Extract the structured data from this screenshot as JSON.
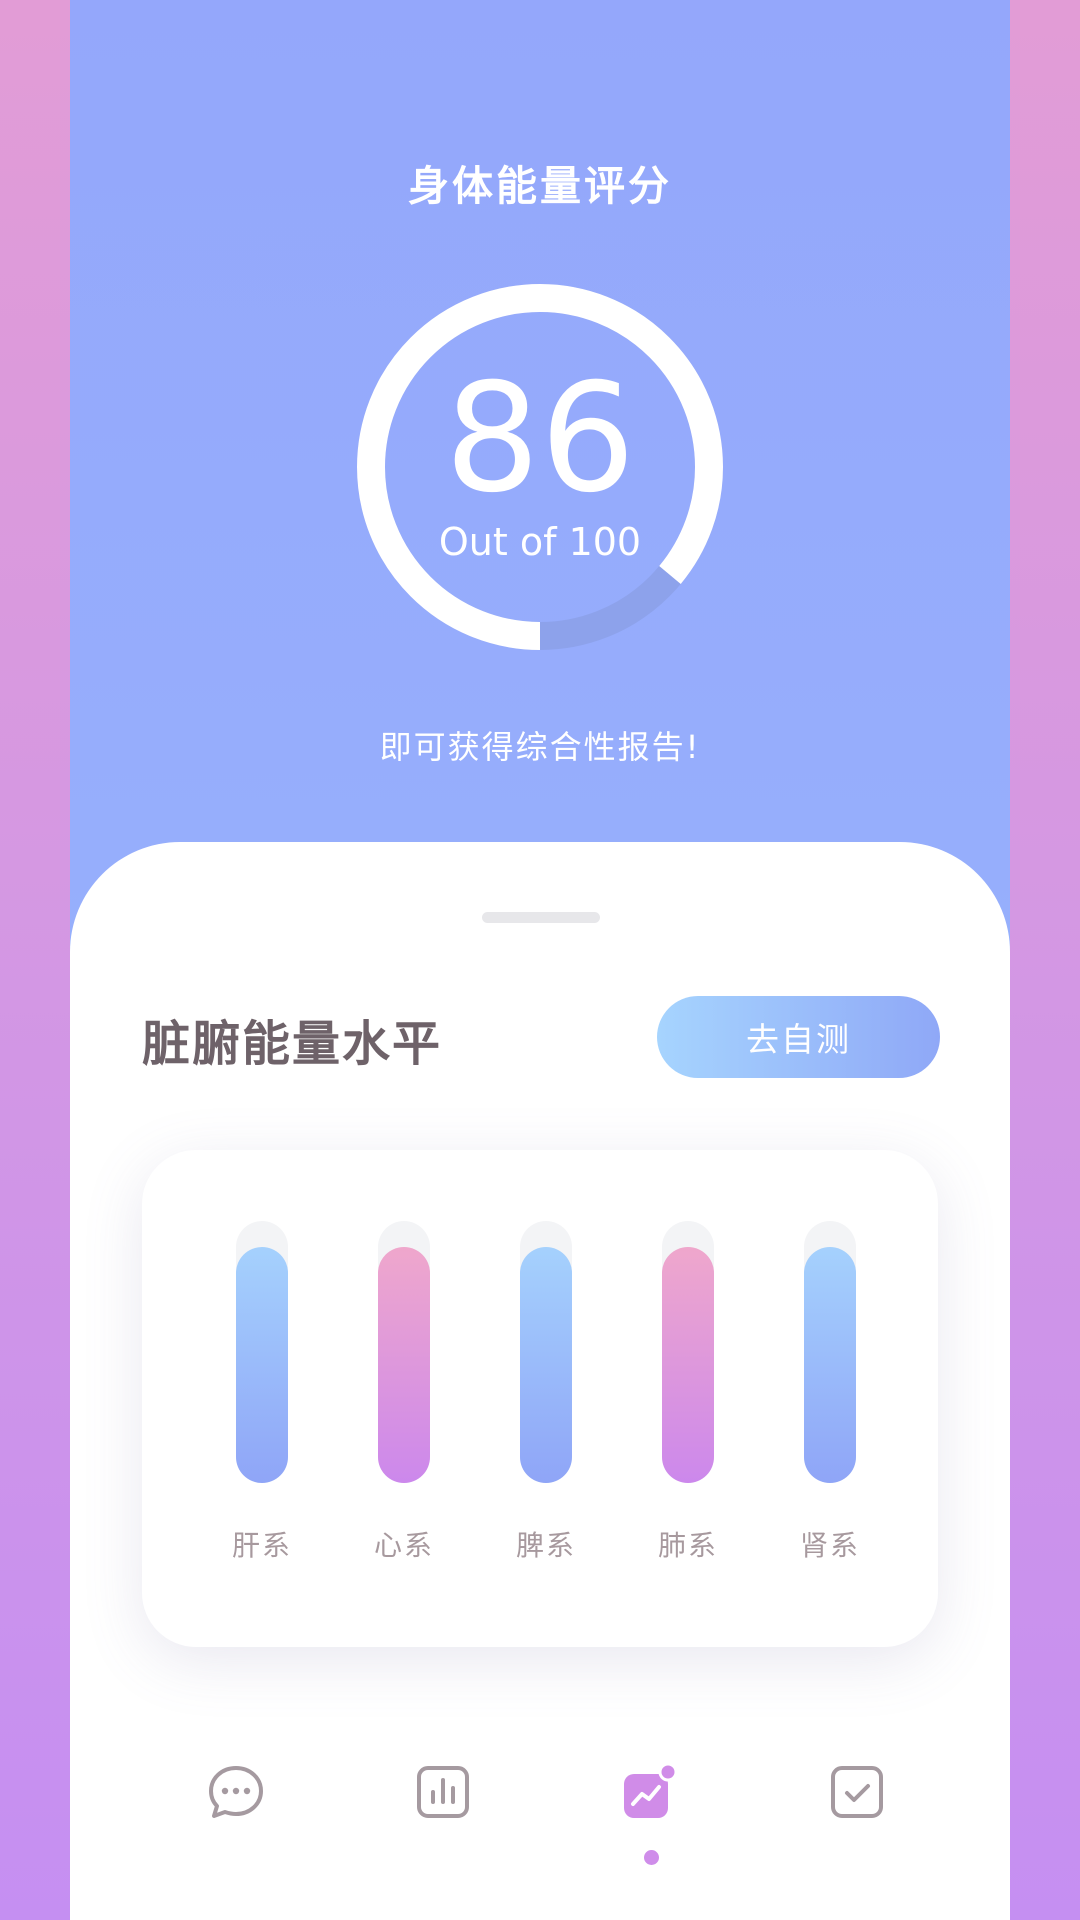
{
  "header": {
    "title": "身体能量评分",
    "score": "86",
    "score_caption": "Out of 100",
    "score_fraction": 0.86,
    "subtitle": "即可获得综合性报告!"
  },
  "sheet": {
    "section_title": "脏腑能量水平",
    "test_button_label": "去自测"
  },
  "organs": [
    {
      "label": "肝系",
      "level": 0.9,
      "color": "blue"
    },
    {
      "label": "心系",
      "level": 0.9,
      "color": "pink"
    },
    {
      "label": "脾系",
      "level": 0.9,
      "color": "blue"
    },
    {
      "label": "肺系",
      "level": 0.9,
      "color": "pink"
    },
    {
      "label": "肾系",
      "level": 0.9,
      "color": "blue"
    }
  ],
  "tabbar": {
    "items": [
      {
        "icon": "chat-icon"
      },
      {
        "icon": "bar-chart-icon"
      },
      {
        "icon": "trend-chart-icon",
        "active": true
      },
      {
        "icon": "checkbox-icon"
      }
    ]
  },
  "colors": {
    "accent_blue": "#94A7FB",
    "accent_purple": "#CF8DEA",
    "bar_blue_top": "#A5D1FD",
    "bar_pink_top": "#EFA7CC"
  }
}
